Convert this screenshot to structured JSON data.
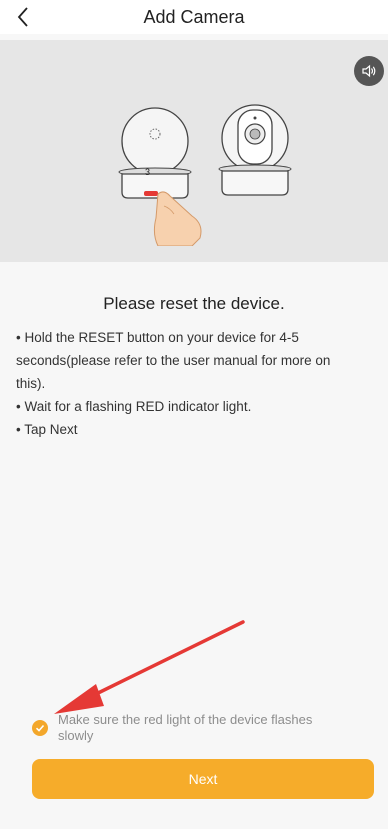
{
  "header": {
    "title": "Add Camera",
    "back_icon": "chevron-left-icon"
  },
  "hero": {
    "sound_icon": "speaker-icon",
    "camera_label": "3"
  },
  "main": {
    "heading": "Please reset the device.",
    "instructions": [
      "• Hold the RESET button on your device for 4-5",
      "seconds(please refer to the user manual for more on",
      "this).",
      "• Wait for a flashing RED indicator light.",
      "• Tap Next"
    ]
  },
  "confirm": {
    "checked": true,
    "text_line1": "Make sure the red light of the device flashes",
    "text_line2": "slowly"
  },
  "next_button": {
    "label": "Next"
  },
  "colors": {
    "accent": "#f6ac2a",
    "arrow": "#e53935"
  }
}
